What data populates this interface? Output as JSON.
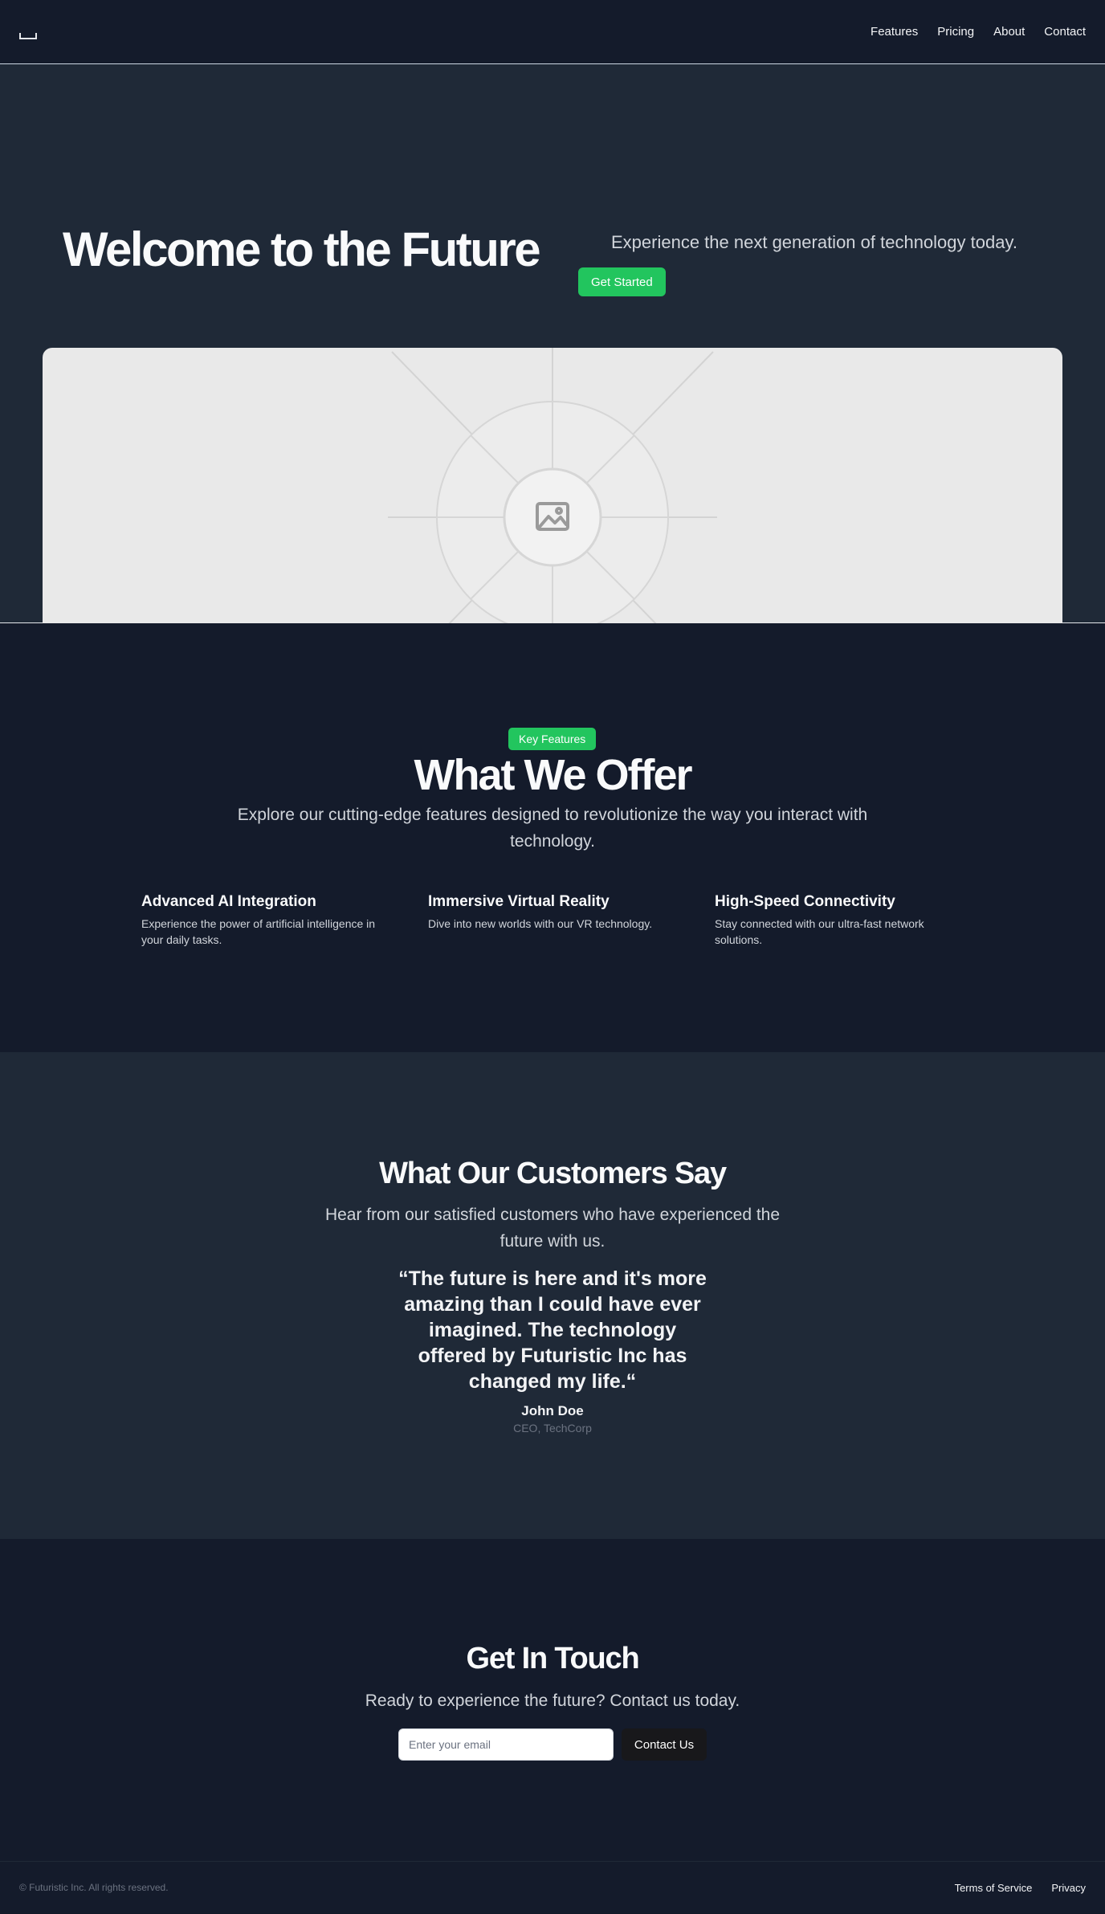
{
  "header": {
    "nav": [
      "Features",
      "Pricing",
      "About",
      "Contact"
    ]
  },
  "hero": {
    "title": "Welcome to the Future",
    "subtitle": "Experience the next generation of technology today.",
    "cta_label": "Get Started",
    "image_icon": "image-placeholder-icon"
  },
  "features": {
    "badge": "Key Features",
    "title": "What We Offer",
    "description": "Explore our cutting-edge features designed to revolutionize the way you interact with technology.",
    "items": [
      {
        "title": "Advanced AI Integration",
        "description": "Experience the power of artificial intelligence in your daily tasks."
      },
      {
        "title": "Immersive Virtual Reality",
        "description": "Dive into new worlds with our VR technology."
      },
      {
        "title": "High-Speed Connectivity",
        "description": "Stay connected with our ultra-fast network solutions."
      }
    ]
  },
  "testimonials": {
    "title": "What Our Customers Say",
    "description": "Hear from our satisfied customers who have experienced the future with us.",
    "quote": "“The future is here and it's more amazing than I could have ever imagined. The technology offered by Futuristic Inc has changed my life.“",
    "author": "John Doe",
    "role": "CEO, TechCorp"
  },
  "contact": {
    "title": "Get In Touch",
    "description": "Ready to experience the future? Contact us today.",
    "email_placeholder": "Enter your email",
    "button_label": "Contact Us"
  },
  "footer": {
    "copyright": "© Futuristic Inc. All rights reserved.",
    "links": [
      "Terms of Service",
      "Privacy"
    ]
  },
  "colors": {
    "accent": "#22c55e",
    "dark_bg": "#141b2b",
    "section_bg": "#1f2937"
  }
}
